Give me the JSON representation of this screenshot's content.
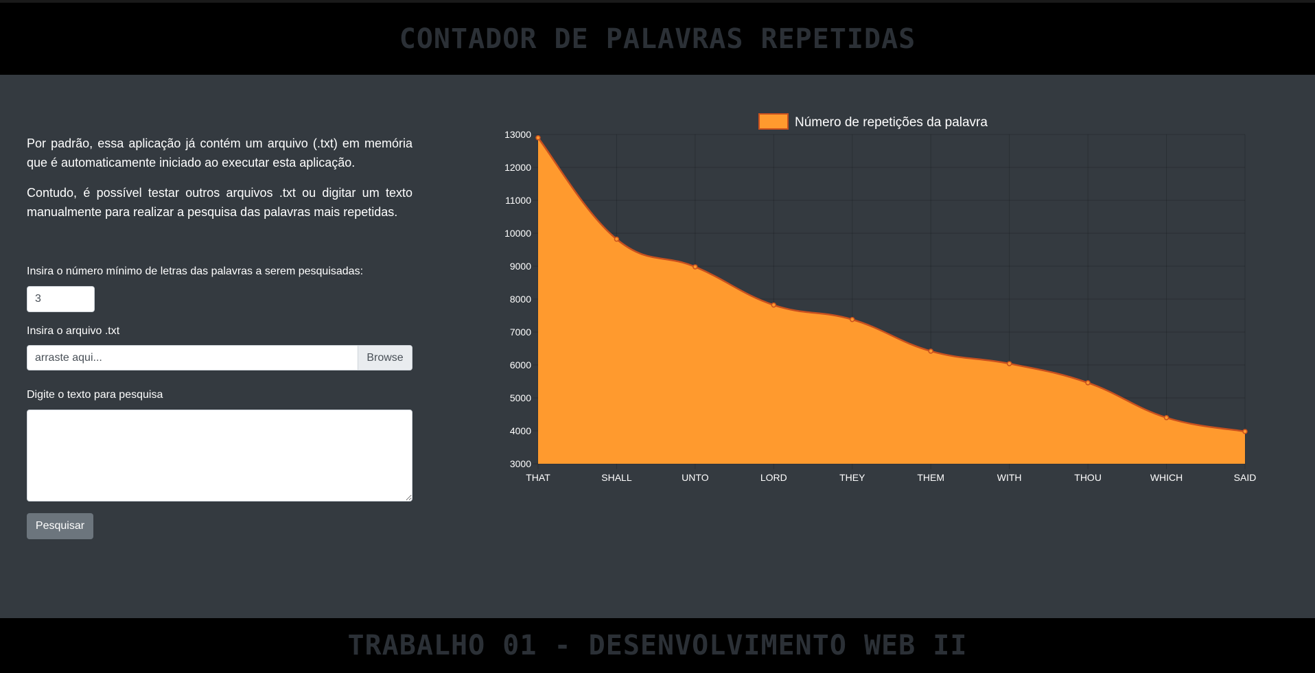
{
  "header": {
    "title": "CONTADOR DE PALAVRAS REPETIDAS"
  },
  "footer": {
    "title": "TRABALHO 01 - DESENVOLVIMENTO WEB II"
  },
  "form": {
    "intro_1": "Por padrão, essa aplicação já contém um arquivo (.txt) em memória que é automaticamente iniciado ao executar esta aplicação.",
    "intro_2": "Contudo, é possível testar outros arquivos .txt ou digitar um texto manualmente para realizar a pesquisa das palavras mais repetidas.",
    "min_letters_label": "Insira o número mínimo de letras das palavras a serem pesquisadas:",
    "min_letters_value": "3",
    "file_label": "Insira o arquivo .txt",
    "file_placeholder": "arraste aqui...",
    "browse_label": "Browse",
    "text_label": "Digite o texto para pesquisa",
    "text_value": "",
    "search_label": "Pesquisar"
  },
  "chart_data": {
    "type": "area",
    "categories": [
      "THAT",
      "SHALL",
      "UNTO",
      "LORD",
      "THEY",
      "THEM",
      "WITH",
      "THOU",
      "WHICH",
      "SAID"
    ],
    "series": [
      {
        "name": "Número de repetições da palavra",
        "values": [
          12900,
          9820,
          8980,
          7820,
          7380,
          6420,
          6040,
          5460,
          4400,
          3980
        ],
        "fill_color": "#ff9a2e",
        "line_color": "#c8501e"
      }
    ],
    "ylim": [
      3000,
      13000
    ],
    "yticks": [
      3000,
      4000,
      5000,
      6000,
      7000,
      8000,
      9000,
      10000,
      11000,
      12000,
      13000
    ],
    "legend": "top",
    "grid": true
  }
}
